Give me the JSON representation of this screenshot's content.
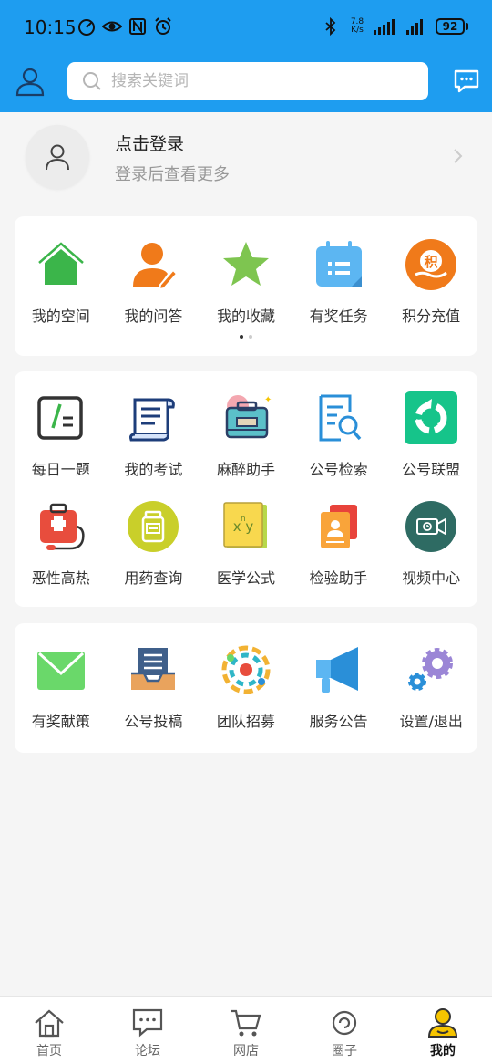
{
  "status": {
    "time": "10:15",
    "speed_value": "7.8",
    "speed_unit": "K/s",
    "battery": "92"
  },
  "search": {
    "placeholder": "搜索关键词"
  },
  "login": {
    "title": "点击登录",
    "subtitle": "登录后查看更多"
  },
  "row1": [
    {
      "label": "我的空间",
      "icon": "home-icon"
    },
    {
      "label": "我的问答",
      "icon": "user-edit-icon"
    },
    {
      "label": "我的收藏",
      "icon": "star-icon"
    },
    {
      "label": "有奖任务",
      "icon": "calendar-task-icon"
    },
    {
      "label": "积分充值",
      "icon": "points-icon"
    }
  ],
  "grid": [
    {
      "label": "每日一题",
      "icon": "daily-question-icon"
    },
    {
      "label": "我的考试",
      "icon": "exam-scroll-icon"
    },
    {
      "label": "麻醉助手",
      "icon": "anesthesia-kit-icon"
    },
    {
      "label": "公号检索",
      "icon": "document-search-icon"
    },
    {
      "label": "公号联盟",
      "icon": "alliance-icon"
    },
    {
      "label": "恶性高热",
      "icon": "first-aid-icon"
    },
    {
      "label": "用药查询",
      "icon": "medicine-bottle-icon"
    },
    {
      "label": "医学公式",
      "icon": "formula-book-icon"
    },
    {
      "label": "检验助手",
      "icon": "lab-report-icon"
    },
    {
      "label": "视频中心",
      "icon": "video-camera-icon"
    }
  ],
  "row3": [
    {
      "label": "有奖献策",
      "icon": "mail-icon"
    },
    {
      "label": "公号投稿",
      "icon": "submission-tray-icon"
    },
    {
      "label": "团队招募",
      "icon": "team-recruit-icon"
    },
    {
      "label": "服务公告",
      "icon": "megaphone-icon"
    },
    {
      "label": "设置/退出",
      "icon": "settings-gears-icon"
    }
  ],
  "tabs": [
    {
      "label": "首页",
      "icon": "home-tab-icon"
    },
    {
      "label": "论坛",
      "icon": "forum-tab-icon"
    },
    {
      "label": "网店",
      "icon": "cart-tab-icon"
    },
    {
      "label": "圈子",
      "icon": "circle-tab-icon"
    },
    {
      "label": "我的",
      "icon": "me-tab-icon",
      "active": true
    }
  ],
  "colors": {
    "brand_blue": "#1e9df0",
    "green": "#3bb54a",
    "orange": "#f07a1a",
    "yellow": "#f5c400"
  }
}
